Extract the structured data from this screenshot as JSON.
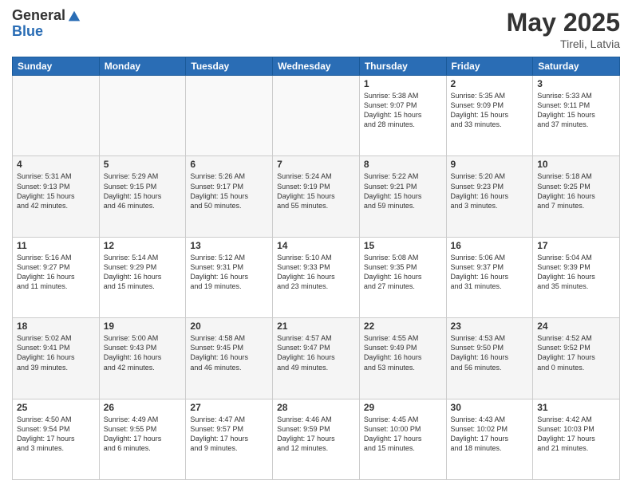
{
  "header": {
    "logo_general": "General",
    "logo_blue": "Blue",
    "month_year": "May 2025",
    "location": "Tireli, Latvia"
  },
  "days_of_week": [
    "Sunday",
    "Monday",
    "Tuesday",
    "Wednesday",
    "Thursday",
    "Friday",
    "Saturday"
  ],
  "weeks": [
    [
      {
        "day": "",
        "info": ""
      },
      {
        "day": "",
        "info": ""
      },
      {
        "day": "",
        "info": ""
      },
      {
        "day": "",
        "info": ""
      },
      {
        "day": "1",
        "info": "Sunrise: 5:38 AM\nSunset: 9:07 PM\nDaylight: 15 hours\nand 28 minutes."
      },
      {
        "day": "2",
        "info": "Sunrise: 5:35 AM\nSunset: 9:09 PM\nDaylight: 15 hours\nand 33 minutes."
      },
      {
        "day": "3",
        "info": "Sunrise: 5:33 AM\nSunset: 9:11 PM\nDaylight: 15 hours\nand 37 minutes."
      }
    ],
    [
      {
        "day": "4",
        "info": "Sunrise: 5:31 AM\nSunset: 9:13 PM\nDaylight: 15 hours\nand 42 minutes."
      },
      {
        "day": "5",
        "info": "Sunrise: 5:29 AM\nSunset: 9:15 PM\nDaylight: 15 hours\nand 46 minutes."
      },
      {
        "day": "6",
        "info": "Sunrise: 5:26 AM\nSunset: 9:17 PM\nDaylight: 15 hours\nand 50 minutes."
      },
      {
        "day": "7",
        "info": "Sunrise: 5:24 AM\nSunset: 9:19 PM\nDaylight: 15 hours\nand 55 minutes."
      },
      {
        "day": "8",
        "info": "Sunrise: 5:22 AM\nSunset: 9:21 PM\nDaylight: 15 hours\nand 59 minutes."
      },
      {
        "day": "9",
        "info": "Sunrise: 5:20 AM\nSunset: 9:23 PM\nDaylight: 16 hours\nand 3 minutes."
      },
      {
        "day": "10",
        "info": "Sunrise: 5:18 AM\nSunset: 9:25 PM\nDaylight: 16 hours\nand 7 minutes."
      }
    ],
    [
      {
        "day": "11",
        "info": "Sunrise: 5:16 AM\nSunset: 9:27 PM\nDaylight: 16 hours\nand 11 minutes."
      },
      {
        "day": "12",
        "info": "Sunrise: 5:14 AM\nSunset: 9:29 PM\nDaylight: 16 hours\nand 15 minutes."
      },
      {
        "day": "13",
        "info": "Sunrise: 5:12 AM\nSunset: 9:31 PM\nDaylight: 16 hours\nand 19 minutes."
      },
      {
        "day": "14",
        "info": "Sunrise: 5:10 AM\nSunset: 9:33 PM\nDaylight: 16 hours\nand 23 minutes."
      },
      {
        "day": "15",
        "info": "Sunrise: 5:08 AM\nSunset: 9:35 PM\nDaylight: 16 hours\nand 27 minutes."
      },
      {
        "day": "16",
        "info": "Sunrise: 5:06 AM\nSunset: 9:37 PM\nDaylight: 16 hours\nand 31 minutes."
      },
      {
        "day": "17",
        "info": "Sunrise: 5:04 AM\nSunset: 9:39 PM\nDaylight: 16 hours\nand 35 minutes."
      }
    ],
    [
      {
        "day": "18",
        "info": "Sunrise: 5:02 AM\nSunset: 9:41 PM\nDaylight: 16 hours\nand 39 minutes."
      },
      {
        "day": "19",
        "info": "Sunrise: 5:00 AM\nSunset: 9:43 PM\nDaylight: 16 hours\nand 42 minutes."
      },
      {
        "day": "20",
        "info": "Sunrise: 4:58 AM\nSunset: 9:45 PM\nDaylight: 16 hours\nand 46 minutes."
      },
      {
        "day": "21",
        "info": "Sunrise: 4:57 AM\nSunset: 9:47 PM\nDaylight: 16 hours\nand 49 minutes."
      },
      {
        "day": "22",
        "info": "Sunrise: 4:55 AM\nSunset: 9:49 PM\nDaylight: 16 hours\nand 53 minutes."
      },
      {
        "day": "23",
        "info": "Sunrise: 4:53 AM\nSunset: 9:50 PM\nDaylight: 16 hours\nand 56 minutes."
      },
      {
        "day": "24",
        "info": "Sunrise: 4:52 AM\nSunset: 9:52 PM\nDaylight: 17 hours\nand 0 minutes."
      }
    ],
    [
      {
        "day": "25",
        "info": "Sunrise: 4:50 AM\nSunset: 9:54 PM\nDaylight: 17 hours\nand 3 minutes."
      },
      {
        "day": "26",
        "info": "Sunrise: 4:49 AM\nSunset: 9:55 PM\nDaylight: 17 hours\nand 6 minutes."
      },
      {
        "day": "27",
        "info": "Sunrise: 4:47 AM\nSunset: 9:57 PM\nDaylight: 17 hours\nand 9 minutes."
      },
      {
        "day": "28",
        "info": "Sunrise: 4:46 AM\nSunset: 9:59 PM\nDaylight: 17 hours\nand 12 minutes."
      },
      {
        "day": "29",
        "info": "Sunrise: 4:45 AM\nSunset: 10:00 PM\nDaylight: 17 hours\nand 15 minutes."
      },
      {
        "day": "30",
        "info": "Sunrise: 4:43 AM\nSunset: 10:02 PM\nDaylight: 17 hours\nand 18 minutes."
      },
      {
        "day": "31",
        "info": "Sunrise: 4:42 AM\nSunset: 10:03 PM\nDaylight: 17 hours\nand 21 minutes."
      }
    ]
  ]
}
